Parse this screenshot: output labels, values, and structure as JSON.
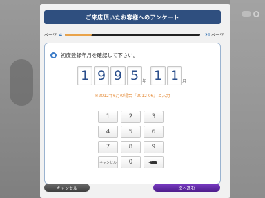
{
  "header": {
    "title": "ご来店頂いたお客様へのアンケート"
  },
  "progress": {
    "page_label": "ページ",
    "current_page": "4",
    "total_pages": "20",
    "total_suffix": "ページ",
    "fraction": 0.2,
    "fill_color": "#e9a34a"
  },
  "question": {
    "icon": "info-circle-icon",
    "text": "初度登録年月を確認して下さい。"
  },
  "entry": {
    "year_digits": [
      "1",
      "9",
      "9",
      "5"
    ],
    "year_unit": "年",
    "month_digits": [
      "1",
      "1"
    ],
    "month_unit": "月",
    "hint": "※2012年6月の場合『2012 06』と入力"
  },
  "keypad": {
    "keys": [
      "1",
      "2",
      "3",
      "4",
      "5",
      "6",
      "7",
      "8",
      "9",
      "キャンセル",
      "0",
      "backspace"
    ]
  },
  "footer": {
    "cancel_label": "キャンセル",
    "next_label": "次へ進む"
  },
  "colors": {
    "title_bar": "#2f4f7f",
    "digit_text": "#2b4f8c",
    "hint_text": "#e48a36",
    "next_button": "#5b2aa3"
  }
}
